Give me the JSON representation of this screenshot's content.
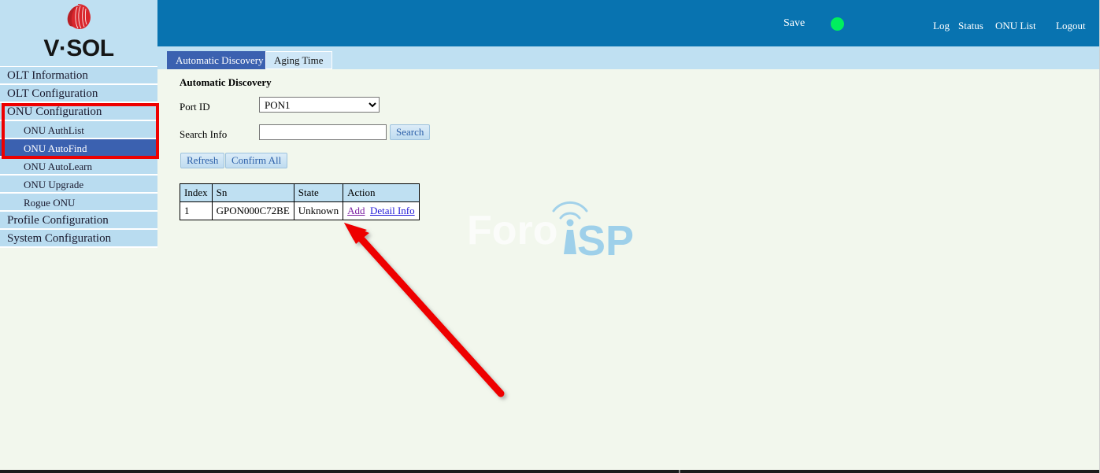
{
  "brand": {
    "name": "V·SOL",
    "logo_icon": "vsol-sphere-logo",
    "logo_color": "#d9262c"
  },
  "header": {
    "save_label": "Save",
    "status_dot_icon": "status-indicator-dot",
    "status_dot_color": "#00ee5e",
    "links": [
      {
        "label": "Log"
      },
      {
        "label": "Status"
      },
      {
        "label": "ONU List"
      },
      {
        "label": "Logout"
      }
    ],
    "bar_color": "#0873b0"
  },
  "sidebar": {
    "items": [
      {
        "label": "OLT Information",
        "level": "top",
        "active": false
      },
      {
        "label": "OLT Configuration",
        "level": "top",
        "active": false
      },
      {
        "label": "ONU Configuration",
        "level": "top",
        "active": false
      },
      {
        "label": "ONU AuthList",
        "level": "sub",
        "active": false
      },
      {
        "label": "ONU AutoFind",
        "level": "sub",
        "active": true
      },
      {
        "label": "ONU AutoLearn",
        "level": "sub",
        "active": false
      },
      {
        "label": "ONU Upgrade",
        "level": "sub",
        "active": false
      },
      {
        "label": "Rogue ONU",
        "level": "sub",
        "active": false
      },
      {
        "label": "Profile Configuration",
        "level": "top",
        "active": false
      },
      {
        "label": "System Configuration",
        "level": "top",
        "active": false
      }
    ],
    "item_bg": "#b9dcf0",
    "active_bg": "#3b61b0"
  },
  "annotations": {
    "highlight_box_color": "#ee0000",
    "arrow_color": "#ee0000",
    "arrow_points_to": "Add"
  },
  "tabs": [
    {
      "label": "Automatic Discovery",
      "active": true
    },
    {
      "label": "Aging Time",
      "active": false
    }
  ],
  "main": {
    "heading": "Automatic Discovery",
    "fields": {
      "port_id_label": "Port ID",
      "port_id_value": "PON1",
      "port_id_options": [
        "PON1"
      ],
      "search_info_label": "Search Info",
      "search_info_value": "",
      "search_info_placeholder": ""
    },
    "buttons": {
      "search": "Search",
      "refresh": "Refresh",
      "confirm_all": "Confirm All"
    },
    "table": {
      "columns": [
        "Index",
        "Sn",
        "State",
        "Action"
      ],
      "rows": [
        {
          "index": "1",
          "sn": "GPON000C72BE",
          "state": "Unknown",
          "action_add": "Add",
          "action_detail": "Detail Info"
        }
      ]
    }
  },
  "watermark": {
    "text_left": "Foro",
    "text_right": "ISP",
    "icon": "wifi-tower-icon",
    "color": "#9ed0ea"
  }
}
